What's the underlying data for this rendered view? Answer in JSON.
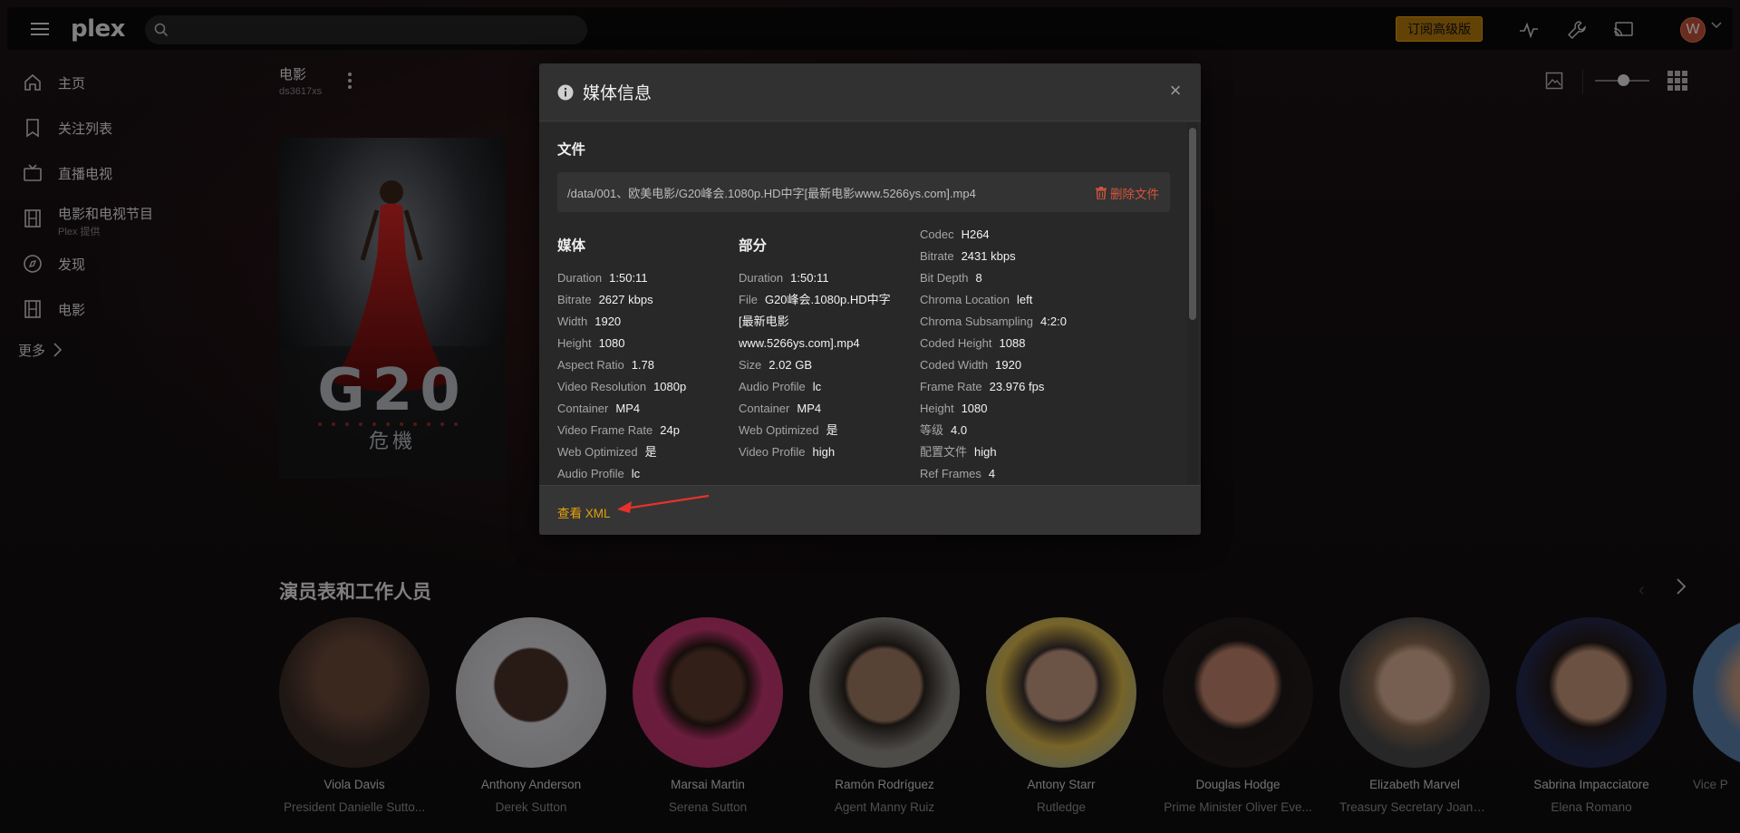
{
  "topbar": {
    "logo": "plex",
    "search_placeholder": "",
    "premium_label": "订阅高级版",
    "avatar_initial": "W"
  },
  "sidebar": {
    "items": [
      {
        "label": "主页",
        "icon": "home-icon"
      },
      {
        "label": "关注列表",
        "icon": "bookmark-icon"
      },
      {
        "label": "直播电视",
        "icon": "tv-icon"
      },
      {
        "label": "电影和电视节目",
        "sub": "Plex 提供",
        "icon": "film-icon"
      },
      {
        "label": "发现",
        "icon": "compass-icon"
      },
      {
        "label": "电影",
        "icon": "film-icon"
      }
    ],
    "more_label": "更多"
  },
  "page": {
    "title": "电影",
    "subtitle": "ds3617xs"
  },
  "modal": {
    "title": "媒体信息",
    "file_section": "文件",
    "file_path": "/data/001、欧美电影/G20峰会.1080p.HD中字[最新电影www.5266ys.com].mp4",
    "delete_label": "删除文件",
    "media_section": "媒体",
    "part_section": "部分",
    "media": [
      {
        "k": "Duration",
        "v": "1:50:11"
      },
      {
        "k": "Bitrate",
        "v": "2627 kbps"
      },
      {
        "k": "Width",
        "v": "1920"
      },
      {
        "k": "Height",
        "v": "1080"
      },
      {
        "k": "Aspect Ratio",
        "v": "1.78"
      },
      {
        "k": "Video Resolution",
        "v": "1080p"
      },
      {
        "k": "Container",
        "v": "MP4"
      },
      {
        "k": "Video Frame Rate",
        "v": "24p"
      },
      {
        "k": "Web Optimized",
        "v": "是"
      },
      {
        "k": "Audio Profile",
        "v": "lc"
      }
    ],
    "part": [
      {
        "k": "Duration",
        "v": "1:50:11"
      },
      {
        "k": "File",
        "v": "G20峰会.1080p.HD中字"
      },
      {
        "k": "",
        "v": "[最新电影"
      },
      {
        "k": "",
        "v": "www.5266ys.com].mp4"
      },
      {
        "k": "Size",
        "v": "2.02 GB"
      },
      {
        "k": "Audio Profile",
        "v": "lc"
      },
      {
        "k": "Container",
        "v": "MP4"
      },
      {
        "k": "Web Optimized",
        "v": "是"
      },
      {
        "k": "Video Profile",
        "v": "high"
      }
    ],
    "stream": [
      {
        "k": "Codec",
        "v": "H264"
      },
      {
        "k": "Bitrate",
        "v": "2431 kbps"
      },
      {
        "k": "Bit Depth",
        "v": "8"
      },
      {
        "k": "Chroma Location",
        "v": "left"
      },
      {
        "k": "Chroma Subsampling",
        "v": "4:2:0"
      },
      {
        "k": "Coded Height",
        "v": "1088"
      },
      {
        "k": "Coded Width",
        "v": "1920"
      },
      {
        "k": "Frame Rate",
        "v": "23.976 fps"
      },
      {
        "k": "Height",
        "v": "1080"
      },
      {
        "k": "等级",
        "v": "4.0"
      },
      {
        "k": "配置文件",
        "v": "high"
      },
      {
        "k": "Ref Frames",
        "v": "4"
      }
    ],
    "xml_label": "查看 XML"
  },
  "poster": {
    "title_text": "G20",
    "subtitle_text": "危機"
  },
  "cast": {
    "title": "演员表和工作人员",
    "people": [
      {
        "name": "Viola Davis",
        "role": "President Danielle Sutto...",
        "color": "#3a2a24"
      },
      {
        "name": "Anthony Anderson",
        "role": "Derek Sutton",
        "color": "#cfcfd4"
      },
      {
        "name": "Marsai Martin",
        "role": "Serena Sutton",
        "color": "#c2356f"
      },
      {
        "name": "Ramón Rodríguez",
        "role": "Agent Manny Ruiz",
        "color": "#8e8a86"
      },
      {
        "name": "Antony Starr",
        "role": "Rutledge",
        "color": "#d8b64a"
      },
      {
        "name": "Douglas Hodge",
        "role": "Prime Minister Oliver Eve...",
        "color": "#2a2020"
      },
      {
        "name": "Elizabeth Marvel",
        "role": "Treasury Secretary Joann...",
        "color": "#4a4747"
      },
      {
        "name": "Sabrina Impacciatore",
        "role": "Elena Romano",
        "color": "#23284a"
      },
      {
        "name": "",
        "role": "Vice P",
        "color": "#5a7ea8"
      }
    ]
  }
}
